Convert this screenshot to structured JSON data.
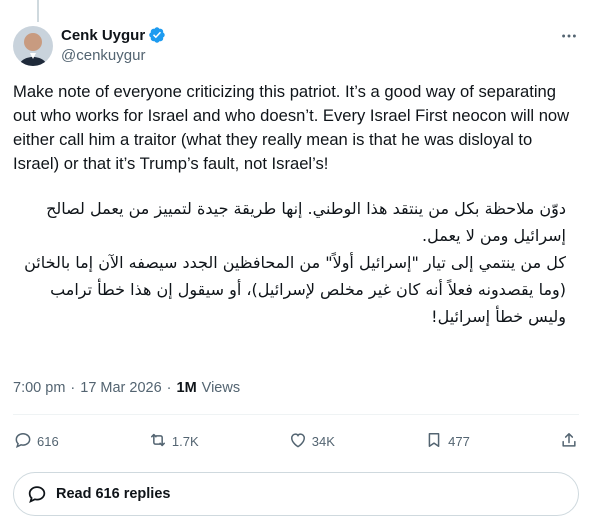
{
  "author": {
    "display_name": "Cenk Uygur",
    "handle": "@cenkuygur",
    "verified_icon": "verified-badge",
    "accent": "#1d9bf0"
  },
  "tweet": {
    "text_en": "Make note of everyone criticizing this patriot. It’s a good way of separating out who works for Israel and who doesn’t. Every Israel First neocon will now either call him a traitor (what they really mean is that he was disloyal to Israel) or that it’s Trump’s fault, not Israel’s!",
    "text_ar_1": "دوّن ملاحظة بكل من ينتقد هذا الوطني. إنها طريقة جيدة لتمييز من يعمل لصالح إسرائيل ومن لا يعمل.",
    "text_ar_2": "كل من ينتمي إلى تيار \"إسرائيل أولاً\" من المحافظين الجدد سيصفه الآن إما بالخائن (وما يقصدونه فعلاً أنه كان غير مخلص لإسرائيل)، أو سيقول إن هذا خطأ ترامب وليس خطأ إسرائيل!"
  },
  "meta": {
    "time": "7:00 pm",
    "separator": "·",
    "date": "17 Mar 2026",
    "views_count": "1M",
    "views_label": "Views"
  },
  "actions": {
    "replies": "616",
    "reposts": "1.7K",
    "likes": "34K",
    "bookmarks": "477"
  },
  "read_replies": "Read 616 replies",
  "colors": {
    "text": "#0f1419",
    "secondary": "#536471",
    "border": "#cfd9de"
  }
}
